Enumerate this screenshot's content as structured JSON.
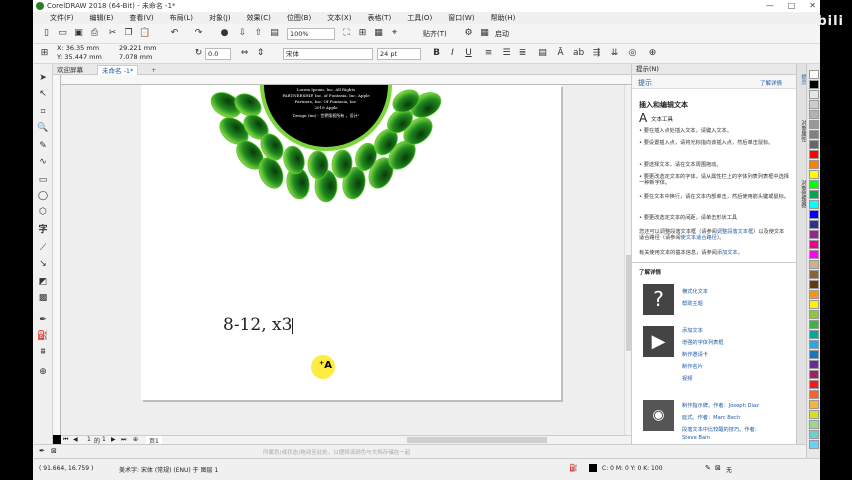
{
  "window": {
    "title": "CorelDRAW 2018 (64-Bit) - 未命名 -1*",
    "controls": [
      "—",
      "□",
      "✕"
    ]
  },
  "watermark": "bilibili",
  "menu": [
    "文件(F)",
    "编辑(E)",
    "查看(V)",
    "布局(L)",
    "对象(J)",
    "效果(C)",
    "位图(B)",
    "文本(X)",
    "表格(T)",
    "工具(O)",
    "窗口(W)",
    "帮助(H)"
  ],
  "toolbar": {
    "zoom": "100%",
    "snap": "贴齐(T)",
    "launch": "启动"
  },
  "propbar": {
    "x": "X: 36.35 mm",
    "y": "Y: 35.447 mm",
    "w": "29.221 mm",
    "h": "7.078 mm",
    "rotation": "0.0",
    "font": "宋体",
    "size": "24 pt"
  },
  "tabs": {
    "welcome": "欢迎屏幕",
    "doc": "未命名 -1*"
  },
  "canvas": {
    "logo_text": [
      "Lorem Ipsum, Inc. All Rights",
      "PARTNERSHIP, Inc. of Funtasia, Inc. Apple",
      "Partners, Inc. Of Funtasia, Inc.",
      "2018 Apple",
      "Design (tm) - 世界版权所有 ，设计\""
    ],
    "typed_text": "8-12, x3"
  },
  "pages": {
    "current": "1",
    "total": "1",
    "label": "页1"
  },
  "hints": "所属色(或状态)拖动至此处，以便将该颜色与文档存储在一起",
  "status": {
    "coords": "( 91.664, 16.759 )",
    "object": "美术字: 宋体 (常规) (ENU) 于 图层 1",
    "fill": "C: 0 M: 0 Y: 0 K: 100",
    "outline": "无"
  },
  "docker": {
    "title": "提示(N)",
    "subtitle": "提示",
    "more_link": "了解详情",
    "heading": "插入和编辑文本",
    "tool_name": "文本工具",
    "bullets": [
      "要在插入点处插入文本，请键入文本。",
      "要设置插入点，请将光标指向该插入点，然后单击鼠标。",
      "要选择文本，请在文本周围拖动。",
      "要更改选定文本的字体，请从属性栏上的字体列表列表框中选择一种新字体。",
      "要在文本中换行，请在文本内部单击，然后使用箭头键或鼠标。",
      "要更改选定文本的间距，请单击形状工具"
    ],
    "para1_a": "您还可以调整段落文本框（请参阅",
    "para1_link1": "调整段落文本框",
    "para1_b": "）以及使文本适合路径（请参阅",
    "para1_link2": "使文本适合路径",
    "para1_c": "）。",
    "para2_a": "有关使用文本的基本信息，请参阅",
    "para2_link": "添加文本",
    "para2_b": "。",
    "learn_more": "了解详情",
    "group1": [
      "横式化文本",
      "帮助主题"
    ],
    "group2": [
      "添加文本",
      "增强的字体列表框",
      "制作邀请卡",
      "制作名片",
      "视频"
    ],
    "group3": [
      "制作指示牌。作者：Joseph Diaz",
      "延式。作者：Marc Bech",
      "段落文本中比较醒的技巧。作者：",
      "Steve Bain"
    ]
  },
  "side_tabs": [
    "提示",
    "对象属性",
    "对象管理器"
  ],
  "palette_colors": [
    "#ffffff",
    "#000000",
    "#e6e6e6",
    "#cccccc",
    "#b3b3b3",
    "#999999",
    "#808080",
    "#666666",
    "#ff0000",
    "#ff8000",
    "#ffff00",
    "#00ff00",
    "#00a651",
    "#00ffff",
    "#0000ff",
    "#2e3192",
    "#92278f",
    "#ec008c",
    "#ff00ff",
    "#c7b299",
    "#8c6239",
    "#603913",
    "#f7941d",
    "#fff200",
    "#8dc63f",
    "#39b54a",
    "#00a99d",
    "#27aae1",
    "#1c75bc",
    "#662d91",
    "#9e1f63",
    "#ed1c24",
    "#f26522",
    "#fbb040",
    "#d7df23",
    "#a3d39c",
    "#7accc8",
    "#6dcff6"
  ]
}
